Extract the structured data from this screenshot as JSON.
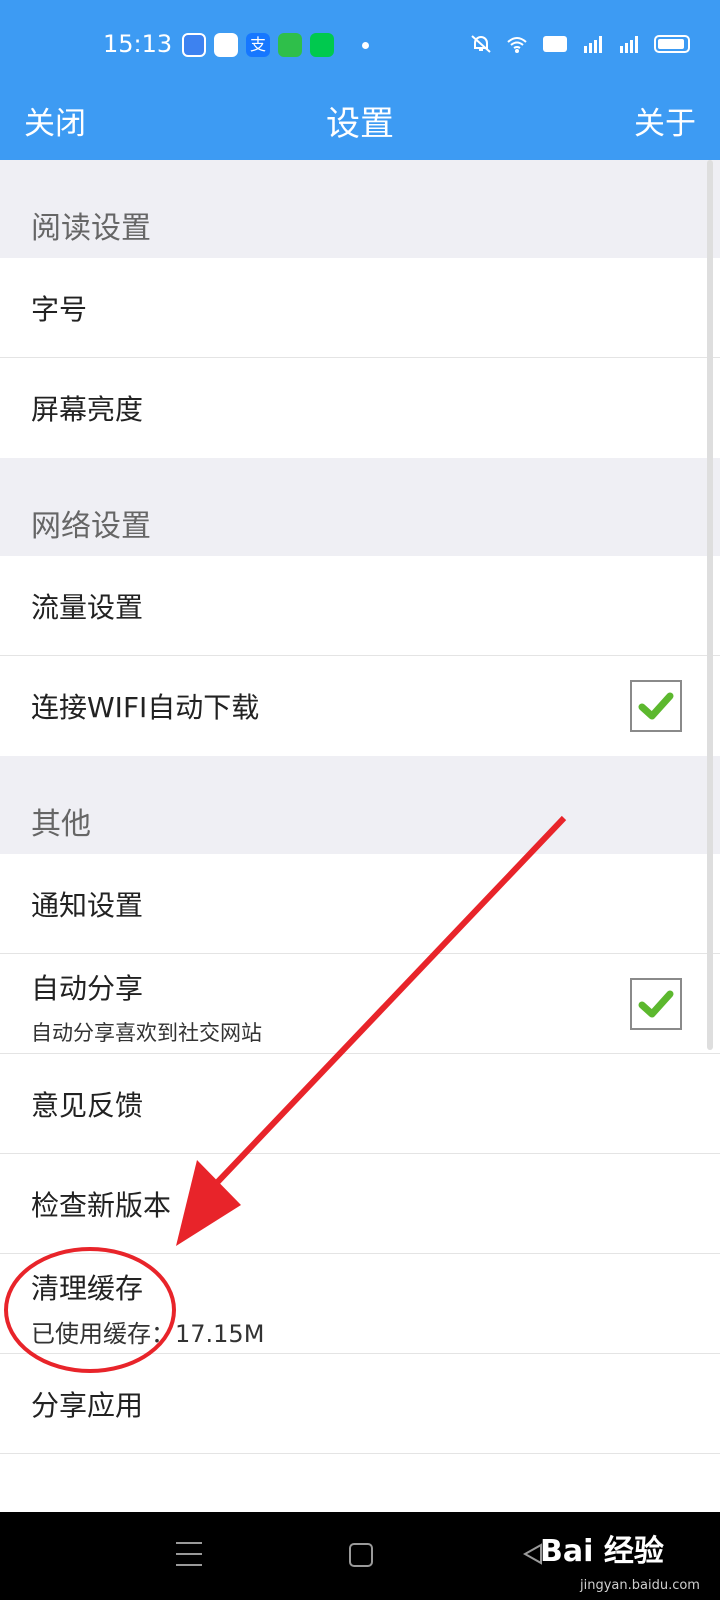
{
  "status_bar": {
    "time": "15:13",
    "app_icons": [
      "message-app-icon",
      "browser-app-icon",
      "alipay-app-icon",
      "video-app-icon",
      "iqiyi-app-icon"
    ],
    "alipay_glyph": "支",
    "right_icons": [
      "mute-bell-icon",
      "wifi-icon",
      "hd-icon",
      "signal-5g-icon",
      "signal-4g-icon",
      "battery-icon"
    ]
  },
  "nav": {
    "left": "关闭",
    "title": "设置",
    "right": "关于"
  },
  "sections": [
    {
      "title": "阅读设置",
      "items": [
        {
          "label": "字号"
        },
        {
          "label": "屏幕亮度"
        }
      ]
    },
    {
      "title": "网络设置",
      "items": [
        {
          "label": "流量设置"
        },
        {
          "label": "连接WIFI自动下载",
          "checked": true
        }
      ]
    },
    {
      "title": "其他",
      "items": [
        {
          "label": "通知设置"
        },
        {
          "label": "自动分享",
          "sub": "自动分享喜欢到社交网站",
          "checked": true
        },
        {
          "label": "意见反馈"
        },
        {
          "label": "检查新版本"
        },
        {
          "label": "清理缓存",
          "sub": "已使用缓存：17.15M"
        },
        {
          "label": "分享应用"
        }
      ]
    }
  ],
  "watermark": {
    "logo": "Bai 经验",
    "url": "jingyan.baidu.com"
  },
  "colors": {
    "header": "#3d9bf3",
    "section_bg": "#efeff4",
    "annotation": "#e8242a",
    "check": "#5cb82e"
  }
}
